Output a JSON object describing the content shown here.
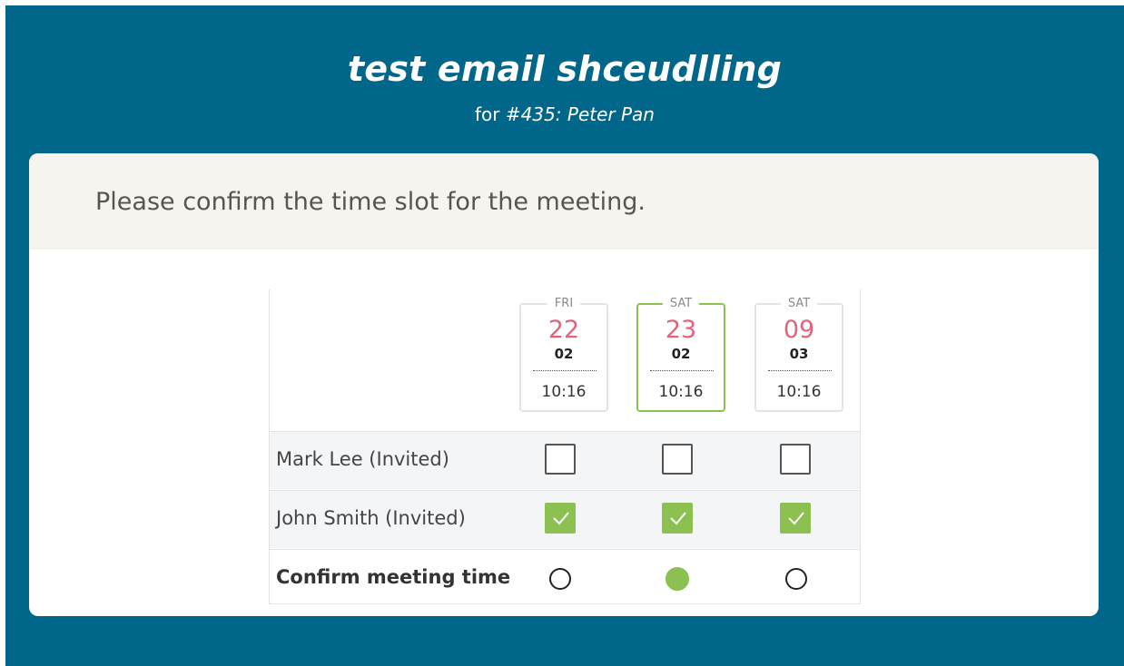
{
  "header": {
    "title": "test email shceudlling",
    "subtitle_prefix": "for ",
    "subtitle_ref": "#435: Peter Pan"
  },
  "prompt": "Please confirm the time slot for the meeting.",
  "slots": [
    {
      "dow": "FRI",
      "day": "22",
      "month": "02",
      "time": "10:16",
      "selected": false
    },
    {
      "dow": "SAT",
      "day": "23",
      "month": "02",
      "time": "10:16",
      "selected": true
    },
    {
      "dow": "SAT",
      "day": "09",
      "month": "03",
      "time": "10:16",
      "selected": false
    }
  ],
  "participants": [
    {
      "label": "Mark Lee (Invited)",
      "checks": [
        false,
        false,
        false
      ]
    },
    {
      "label": "John Smith (Invited)",
      "checks": [
        true,
        true,
        true
      ]
    }
  ],
  "confirm": {
    "label": "Confirm meeting time",
    "selected_index": 1
  },
  "colors": {
    "background": "#00678a",
    "accent_green": "#8cc152",
    "date_pink": "#e0647d",
    "header_band": "#f7f3ef"
  }
}
